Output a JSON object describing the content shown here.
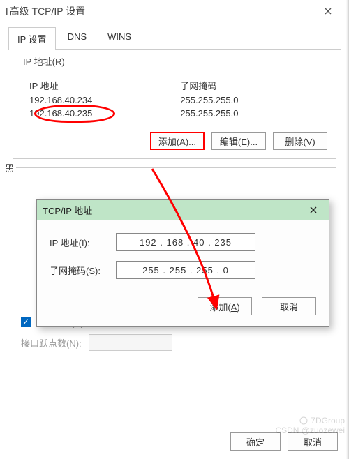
{
  "window": {
    "title": "高级 TCP/IP 设置"
  },
  "tabs": {
    "ip": "IP 设置",
    "dns": "DNS",
    "wins": "WINS"
  },
  "ipgroup": {
    "legend": "IP 地址(R)",
    "col_ip": "IP 地址",
    "col_mask": "子网掩码",
    "rows": [
      {
        "ip": "192.168.40.234",
        "mask": "255.255.255.0"
      },
      {
        "ip": "192.168.40.235",
        "mask": "255.255.255.0"
      }
    ],
    "add": "添加(A)...",
    "edit": "编辑(E)...",
    "del": "删除(V)"
  },
  "modal": {
    "title": "TCP/IP 地址",
    "ip_label": "IP 地址(I):",
    "mask_label": "子网掩码(S):",
    "ip_value": "192 . 168 .  40 . 235",
    "mask_value": "255 . 255 . 255 .  0",
    "add": "添加(A)",
    "cancel": "取消"
  },
  "auto": {
    "auto_metric": "自动跃点(U)",
    "metric_label": "接口跃点数(N):"
  },
  "footer": {
    "ok": "确定",
    "cancel": "取消"
  },
  "watermark": {
    "l1": "7DGroup",
    "l2": "CSDN @zuozewei"
  }
}
